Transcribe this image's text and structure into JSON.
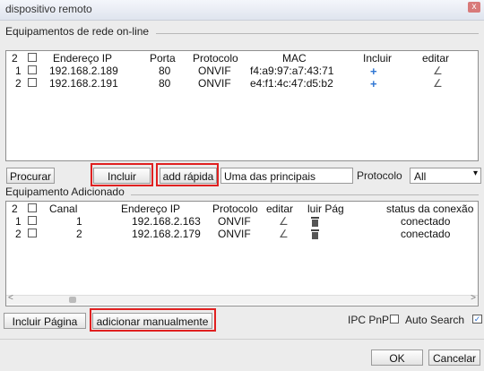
{
  "window": {
    "title": "dispositivo remoto",
    "close_glyph": "x"
  },
  "network": {
    "title": "Equipamentos de rede on-line",
    "header": {
      "count": "2",
      "ip": "Endereço IP",
      "port": "Porta",
      "protocol": "Protocolo",
      "mac": "MAC",
      "include": "Incluir",
      "edit": "editar"
    },
    "rows": [
      {
        "n": "1",
        "ip": "192.168.2.189",
        "port": "80",
        "protocol": "ONVIF",
        "mac": "f4:a9:97:a7:43:71",
        "include_icon": "+",
        "edit_icon": "∠"
      },
      {
        "n": "2",
        "ip": "192.168.2.191",
        "port": "80",
        "protocol": "ONVIF",
        "mac": "e4:f1:4c:47:d5:b2",
        "include_icon": "+",
        "edit_icon": "∠"
      }
    ]
  },
  "toolbar": {
    "search": "Procurar",
    "include": "Incluir",
    "quick_add": "add rápida",
    "note": "Uma das principais mudanç",
    "protocol_label": "Protocolo",
    "protocol_value": "All",
    "dropdown_arrow": "▾"
  },
  "added": {
    "title": "Equipamento Adicionado",
    "header": {
      "count": "2",
      "channel": "Canal",
      "ip": "Endereço IP",
      "protocol": "Protocolo",
      "edit": "editar",
      "page": "luir Pág",
      "status": "status da conexão"
    },
    "rows": [
      {
        "n": "1",
        "channel": "1",
        "ip": "192.168.2.163",
        "protocol": "ONVIF",
        "edit_icon": "∠",
        "status": "conectado"
      },
      {
        "n": "2",
        "channel": "2",
        "ip": "192.168.2.179",
        "protocol": "ONVIF",
        "edit_icon": "∠",
        "status": "conectado"
      }
    ],
    "scroll_left": "<",
    "scroll_right": ">"
  },
  "bottom": {
    "include_page": "Incluir Página",
    "add_manual": "adicionar manualmente",
    "ipc_pnp": "IPC PnP",
    "auto_search": "Auto Search",
    "auto_search_checked": true,
    "ok": "OK",
    "cancel": "Cancelar"
  },
  "colors": {
    "highlight": "#e02020",
    "plus": "#2f76d3"
  }
}
